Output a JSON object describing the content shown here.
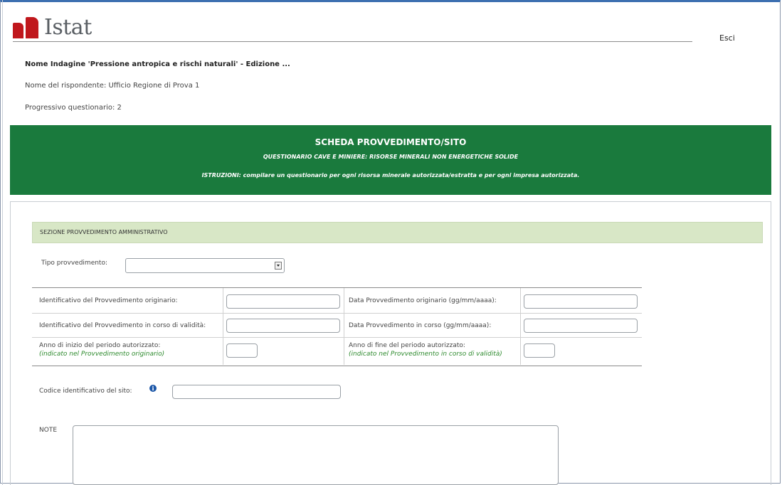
{
  "header": {
    "logo_text": "Istat",
    "logout_label": "Esci"
  },
  "meta": {
    "survey_name": "Nome Indagine 'Pressione antropica e rischi naturali' - Edizione ...",
    "respondent": "Nome del rispondente: Ufficio Regione di Prova 1",
    "progressive": "Progressivo questionario: 2"
  },
  "banner": {
    "title": "SCHEDA PROVVEDIMENTO/SITO",
    "subtitle": "QUESTIONARIO CAVE E MINIERE: RISORSE MINERALI NON ENERGETICHE SOLIDE",
    "instructions": "ISTRUZIONI: compilare un questionario per ogni risorsa minerale autorizzata/estratta e per ogni impresa autorizzata."
  },
  "section": {
    "title": "SEZIONE PROVVEDIMENTO AMMINISTRATIVO"
  },
  "form": {
    "tipo_label": "Tipo provvedimento:",
    "tipo_value": "",
    "id_originario_label": "Identificativo del Provvedimento originario:",
    "data_originario_label": "Data Provvedimento originario (gg/mm/aaaa):",
    "id_corso_label": "Identificativo del Provvedimento in corso di validità:",
    "data_corso_label": "Data Provvedimento in corso (gg/mm/aaaa):",
    "anno_inizio_label": "Anno di inizio del periodo autorizzato:",
    "anno_inizio_note": "(indicato nel Provvedimento originario)",
    "anno_fine_label": "Anno di fine del periodo autorizzato:",
    "anno_fine_note": "(indicato nel Provvedimento in corso di validità)",
    "codice_sito_label": "Codice identificativo del sito:",
    "info_glyph": "i",
    "note_label": "NOTE"
  }
}
